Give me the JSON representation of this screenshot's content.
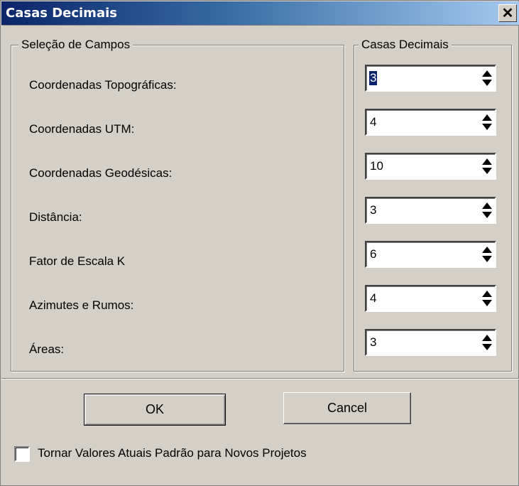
{
  "window": {
    "title": "Casas Decimais",
    "close_glyph": "✕"
  },
  "fields_group": {
    "legend": "Seleção de Campos"
  },
  "decimals_group": {
    "legend": "Casas Decimais"
  },
  "fields": [
    {
      "label": "Coordenadas Topográficas:",
      "value": "3"
    },
    {
      "label": "Coordenadas UTM:",
      "value": "4"
    },
    {
      "label": "Coordenadas Geodésicas:",
      "value": "10"
    },
    {
      "label": "Distância:",
      "value": "3"
    },
    {
      "label": "Fator de Escala K",
      "value": "6"
    },
    {
      "label": "Azimutes e Rumos:",
      "value": "4"
    },
    {
      "label": "Áreas:",
      "value": "3"
    }
  ],
  "buttons": {
    "ok": "OK",
    "cancel": "Cancel"
  },
  "default_checkbox": {
    "label": "Tornar Valores Atuais Padrão para Novos Projetos",
    "checked": false
  }
}
